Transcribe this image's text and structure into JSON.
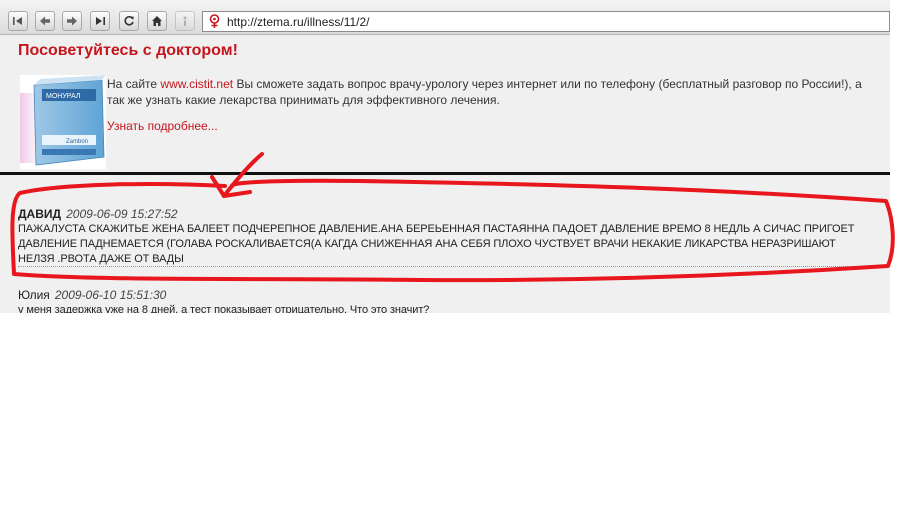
{
  "browser": {
    "url": "http://ztema.ru/illness/11/2/",
    "buttons": [
      "first-page-icon",
      "back-icon",
      "forward-icon",
      "last-page-icon",
      "reload-icon",
      "home-icon",
      "info-icon"
    ]
  },
  "ad": {
    "heading": "Посоветуйтесь с доктором!",
    "text_before": "На сайте ",
    "link": "www.cistit.net",
    "text_after": " Вы сможете задать вопрос врачу-урологу через интернет или по телефону (бесплатный разговор по России!), а так же узнать какие лекарства принимать для эффективного лечения.",
    "more": "Узнать подробнее...",
    "product_label": "МОНУРАЛ",
    "product_brand": "Zambon"
  },
  "comments": [
    {
      "author": "ДАВИД",
      "date": "2009-06-09 15:27:52",
      "text": "ПАЖАЛУСТА СКАЖИТЬЕ ЖЕНА БАЛЕЕТ ПОДЧЕРЕПНОЕ ДАВЛЕНИЕ.АНА БЕРЕЬЕННАЯ ПАСТАЯННА ПАДОЕТ ДАВЛЕНИЕ ВРЕМО 8 НЕДЛЬ А СИЧАС ПРИГОЕТ ДАВЛЕНИЕ ПАДНЕМАЕТСЯ (ГОЛАВА РОСКАЛИВАЕТСЯ(А КАГДА СНИЖЕННАЯ АНА СЕБЯ ПЛОХО ЧУСТВУЕТ ВРАЧИ НЕКАКИЕ ЛИКАРСТВА НЕРАЗРИШАЮТ НЕЛЗЯ .РВОТА ДАЖЕ ОТ ВАДЫ"
    },
    {
      "author": "Юлия",
      "date": "2009-06-10 15:51:30",
      "text": "у меня задержка уже на 8 дней, а тест показывает отрицательно. Что это значит?"
    }
  ],
  "annotation": {
    "color": "#e8161d"
  }
}
